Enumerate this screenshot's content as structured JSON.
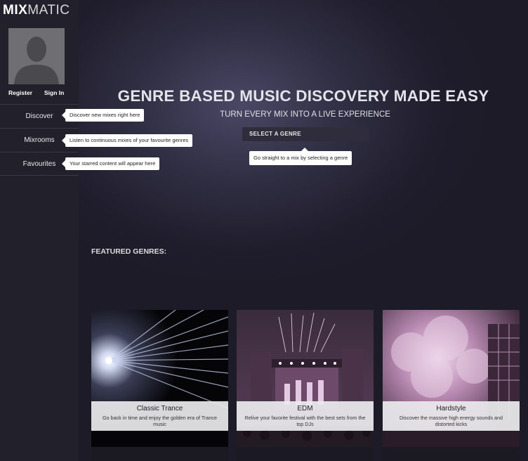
{
  "brand": {
    "logo_bold": "MIX",
    "logo_light": "MATIC"
  },
  "auth": {
    "register": "Register",
    "signin": "Sign In"
  },
  "nav": [
    {
      "label": "Discover",
      "tooltip": "Discover new mixes right here"
    },
    {
      "label": "Mixrooms",
      "tooltip": "Listen to continuous mixes of your favourite genres"
    },
    {
      "label": "Favourites",
      "tooltip": "Your starred content will appear here"
    }
  ],
  "hero": {
    "title": "GENRE BASED MUSIC DISCOVERY MADE EASY",
    "subtitle": "TURN EVERY MIX INTO A LIVE EXPERIENCE",
    "select_label": "SELECT A GENRE",
    "select_tooltip": "Go straight to a mix by selecting a genre"
  },
  "featured": {
    "heading": "FEATURED GENRES:",
    "genres": [
      {
        "title": "Classic Trance",
        "description": "Go back in time and enjoy the golden era of Trance music"
      },
      {
        "title": "EDM",
        "description": "Relive your favorite festival with the best sets from the top DJs"
      },
      {
        "title": "Hardstyle",
        "description": "Discover the massive high energy sounds and distorted kicks"
      }
    ]
  },
  "colors": {
    "sidebar": "#22212b",
    "background": "#1e1c2a",
    "accent_pink": "#d9b3d6"
  }
}
